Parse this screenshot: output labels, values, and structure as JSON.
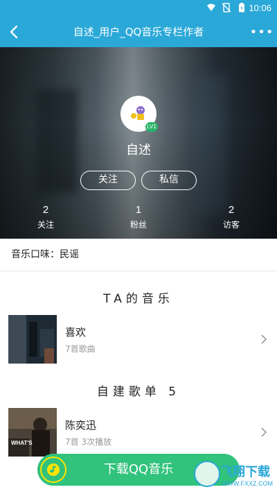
{
  "status_bar": {
    "time": "10:06"
  },
  "app_bar": {
    "title": "自述_用户_QQ音乐专栏作者",
    "back_icon": "chevron-left-icon",
    "more_icon": "more-dots-icon",
    "more_glyph": "•••"
  },
  "profile": {
    "name": "自述",
    "level_badge": "LV1",
    "follow_label": "关注",
    "message_label": "私信",
    "stats": [
      {
        "value": "2",
        "label": "关注"
      },
      {
        "value": "1",
        "label": "粉丝"
      },
      {
        "value": "2",
        "label": "访客"
      }
    ]
  },
  "taste": "音乐口味：民谣",
  "ta_music": {
    "title": "TA的音乐",
    "items": [
      {
        "name": "喜欢",
        "sub": "7首歌曲"
      }
    ]
  },
  "playlists": {
    "title": "自建歌单 5",
    "items": [
      {
        "name": "陈奕迅",
        "sub": "7首 3次播放",
        "cover_text": "WHAT'S"
      }
    ]
  },
  "download": {
    "label": "下载QQ音乐"
  },
  "watermark": {
    "main": "飞翔下载",
    "sub": "WWW.FXXZ.COM"
  },
  "colors": {
    "accent": "#2aa8d8",
    "green": "#31c27c",
    "yellow": "#ffe300"
  }
}
